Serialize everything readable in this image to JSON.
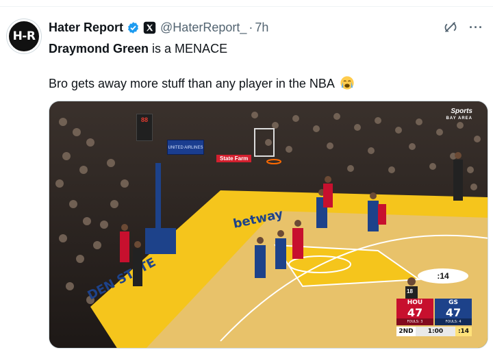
{
  "tweet": {
    "author": {
      "avatar_text": "H-R",
      "display_name": "Hater Report",
      "handle": "@HaterReport_",
      "separator": "·",
      "time": "7h"
    },
    "actions": {
      "more_label": "···"
    },
    "text": {
      "line1_bold": "Draymond Green",
      "line1_rest": " is a MENACE",
      "line2": "Bro gets away more stuff than any player in the NBA"
    }
  },
  "media": {
    "network_logo": "Sports",
    "network_sub": "BAY AREA",
    "court_sponsor": "State Farm",
    "airline_board": "UNITED AIRLINES",
    "arena_clock": "88",
    "court_shot_clock": ":14",
    "ref_number": "18",
    "scoreboard": {
      "home_abbr": "HOU",
      "home_score": "47",
      "home_fouls": "FOULS: 3",
      "away_abbr": "GS",
      "away_score": "47",
      "away_fouls": "FOULS: 4",
      "period": "2ND",
      "clock": "1:00",
      "shot_clock": ":14"
    }
  },
  "colors": {
    "verified": "#1d9bf0",
    "text_secondary": "#536471",
    "court_yellow": "#f5c51c",
    "hou_red": "#c7102e",
    "gs_blue": "#1d428a"
  },
  "icons": [
    "verified-badge-icon",
    "x-logo-icon",
    "grok-icon",
    "more-icon",
    "crying-emoji-icon"
  ]
}
